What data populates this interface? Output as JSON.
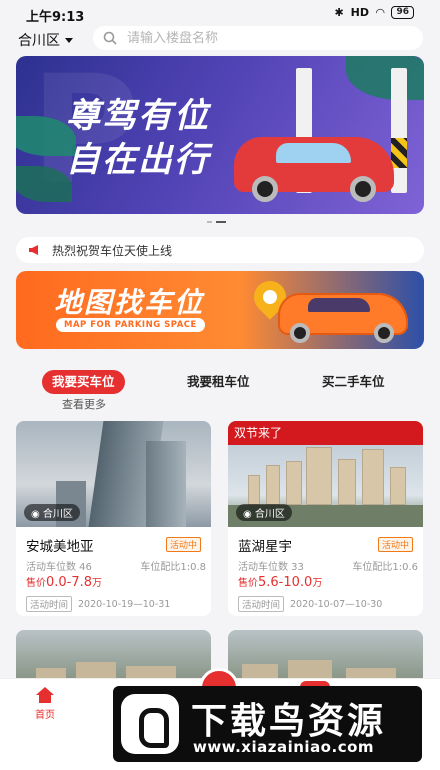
{
  "status_bar": {
    "time": "上午9:13",
    "signal": "HD",
    "battery": "96"
  },
  "header": {
    "city": "合川区",
    "search_placeholder": "请输入楼盘名称"
  },
  "banner": {
    "line1": "尊驾有位",
    "line2": "自在出行"
  },
  "notice": {
    "text": "热烈祝贺车位天使上线"
  },
  "map_banner": {
    "title": "地图找车位",
    "subtitle": "MAP FOR PARKING SPACE"
  },
  "tabs": [
    {
      "label": "我要买车位",
      "active": true
    },
    {
      "label": "我要租车位",
      "active": false
    },
    {
      "label": "买二手车位",
      "active": false
    }
  ],
  "see_more": "查看更多",
  "listings": [
    {
      "district": "合川区",
      "promo": "",
      "name": "安城美地亚",
      "badge": "活动中",
      "spots": "活动车位数 46",
      "ratio": "车位配比1:0.8",
      "price_prefix": "售价",
      "price": "0.0-7.8",
      "price_unit": "万",
      "time_label": "活动时间",
      "time_range": "2020-10-19—10-31"
    },
    {
      "district": "合川区",
      "promo": "双节来了",
      "name": "蓝湖星宇",
      "badge": "活动中",
      "spots": "活动车位数 33",
      "ratio": "车位配比1:0.6",
      "price_prefix": "售价",
      "price": "5.6-10.0",
      "price_unit": "万",
      "time_label": "活动时间",
      "time_range": "2020-10-07—10-30"
    }
  ],
  "nav": {
    "home_label": "首页"
  },
  "watermark": {
    "title": "下载鸟资源",
    "url": "www.xiazainiao.com"
  },
  "colors": {
    "accent": "#e62f2f",
    "badge": "#f07a1a",
    "background": "#f4f4f6"
  }
}
